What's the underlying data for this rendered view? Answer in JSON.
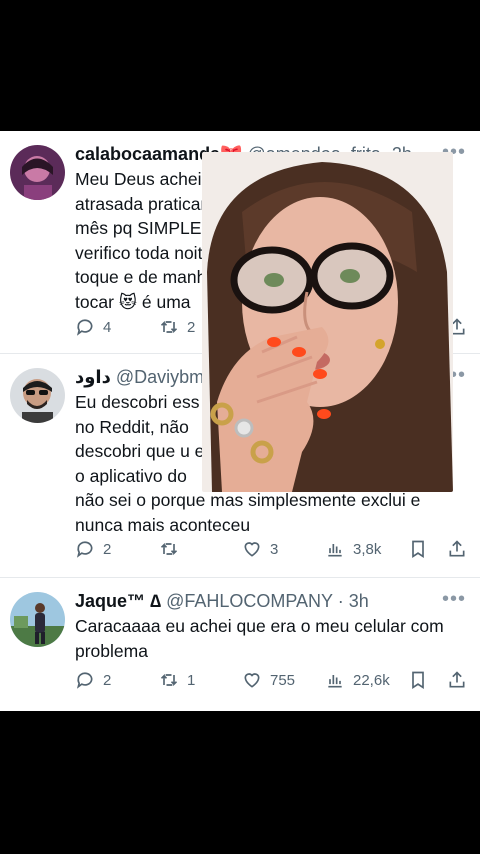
{
  "tweets": [
    {
      "display_name": "calabocaamanda🎀",
      "handle": "@amendoa_frita",
      "time": "· 2h",
      "text": "Meu Deus achei que só eu que acordei\natrasada praticamente o último\nmês pq SIMPLESMENTE o\nverifico toda noite\ntoque e de manhã\ntocar 😻 é uma",
      "replies": "4",
      "retweets": "2",
      "likes": "",
      "views": ""
    },
    {
      "display_name": "داود",
      "handle": "@Daviybm",
      "time": "",
      "text": "Eu descobri ess\nno Reddit, não\ndescobri que u                                              er\no aplicativo do\nnão sei o porque mas simplesmente exclui e\nnunca mais aconteceu",
      "replies": "2",
      "retweets": "",
      "likes": "3",
      "views": "3,8k"
    },
    {
      "display_name": "Jaque™ ∆",
      "handle": "@FAHLOCOMPANY",
      "time": "· 3h",
      "text": "Caracaaaa eu achei que era o meu celular com\nproblema",
      "replies": "2",
      "retweets": "1",
      "likes": "755",
      "views": "22,6k"
    }
  ],
  "icons": {
    "reply": "reply-icon",
    "retweet": "retweet-icon",
    "like": "heart-icon",
    "views": "views-icon",
    "bookmark": "bookmark-icon",
    "share": "share-icon",
    "more": "more-icon"
  },
  "colors": {
    "text": "#0f1419",
    "secondary": "#536471",
    "background": "#ffffff",
    "frame": "#000000"
  }
}
